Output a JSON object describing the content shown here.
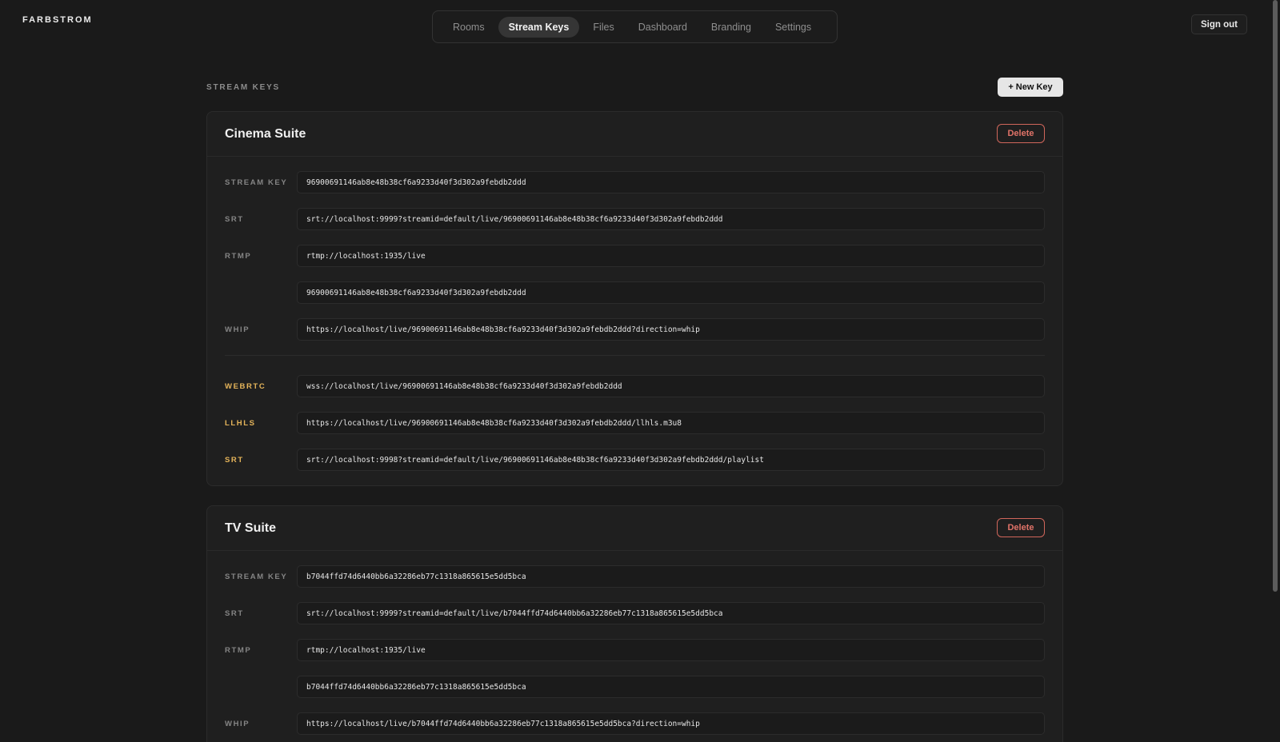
{
  "brand": "FARBSTROM",
  "nav": {
    "tabs": [
      {
        "label": "Rooms"
      },
      {
        "label": "Stream Keys",
        "active": true
      },
      {
        "label": "Files"
      },
      {
        "label": "Dashboard"
      },
      {
        "label": "Branding"
      },
      {
        "label": "Settings"
      }
    ]
  },
  "header": {
    "sign_out": "Sign out"
  },
  "page": {
    "section_title": "STREAM KEYS",
    "new_key": "+ New Key"
  },
  "colors": {
    "accent": "#e5b45a",
    "danger": "#e07368",
    "background": "#1a1a1a"
  },
  "cards": [
    {
      "title": "Cinema Suite",
      "delete": "Delete",
      "ingest": [
        {
          "label": "STREAM KEY",
          "value": "96900691146ab8e48b38cf6a9233d40f3d302a9febdb2ddd"
        },
        {
          "label": "SRT",
          "value": "srt://localhost:9999?streamid=default/live/96900691146ab8e48b38cf6a9233d40f3d302a9febdb2ddd"
        },
        {
          "label": "RTMP",
          "value": "rtmp://localhost:1935/live"
        },
        {
          "label": "",
          "value": "96900691146ab8e48b38cf6a9233d40f3d302a9febdb2ddd"
        },
        {
          "label": "WHIP",
          "value": "https://localhost/live/96900691146ab8e48b38cf6a9233d40f3d302a9febdb2ddd?direction=whip"
        }
      ],
      "playback": [
        {
          "label": "WEBRTC",
          "value": "wss://localhost/live/96900691146ab8e48b38cf6a9233d40f3d302a9febdb2ddd"
        },
        {
          "label": "LLHLS",
          "value": "https://localhost/live/96900691146ab8e48b38cf6a9233d40f3d302a9febdb2ddd/llhls.m3u8"
        },
        {
          "label": "SRT",
          "value": "srt://localhost:9998?streamid=default/live/96900691146ab8e48b38cf6a9233d40f3d302a9febdb2ddd/playlist"
        }
      ]
    },
    {
      "title": "TV Suite",
      "delete": "Delete",
      "ingest": [
        {
          "label": "STREAM KEY",
          "value": "b7044ffd74d6440bb6a32286eb77c1318a865615e5dd5bca"
        },
        {
          "label": "SRT",
          "value": "srt://localhost:9999?streamid=default/live/b7044ffd74d6440bb6a32286eb77c1318a865615e5dd5bca"
        },
        {
          "label": "RTMP",
          "value": "rtmp://localhost:1935/live"
        },
        {
          "label": "",
          "value": "b7044ffd74d6440bb6a32286eb77c1318a865615e5dd5bca"
        },
        {
          "label": "WHIP",
          "value": "https://localhost/live/b7044ffd74d6440bb6a32286eb77c1318a865615e5dd5bca?direction=whip"
        }
      ]
    }
  ]
}
